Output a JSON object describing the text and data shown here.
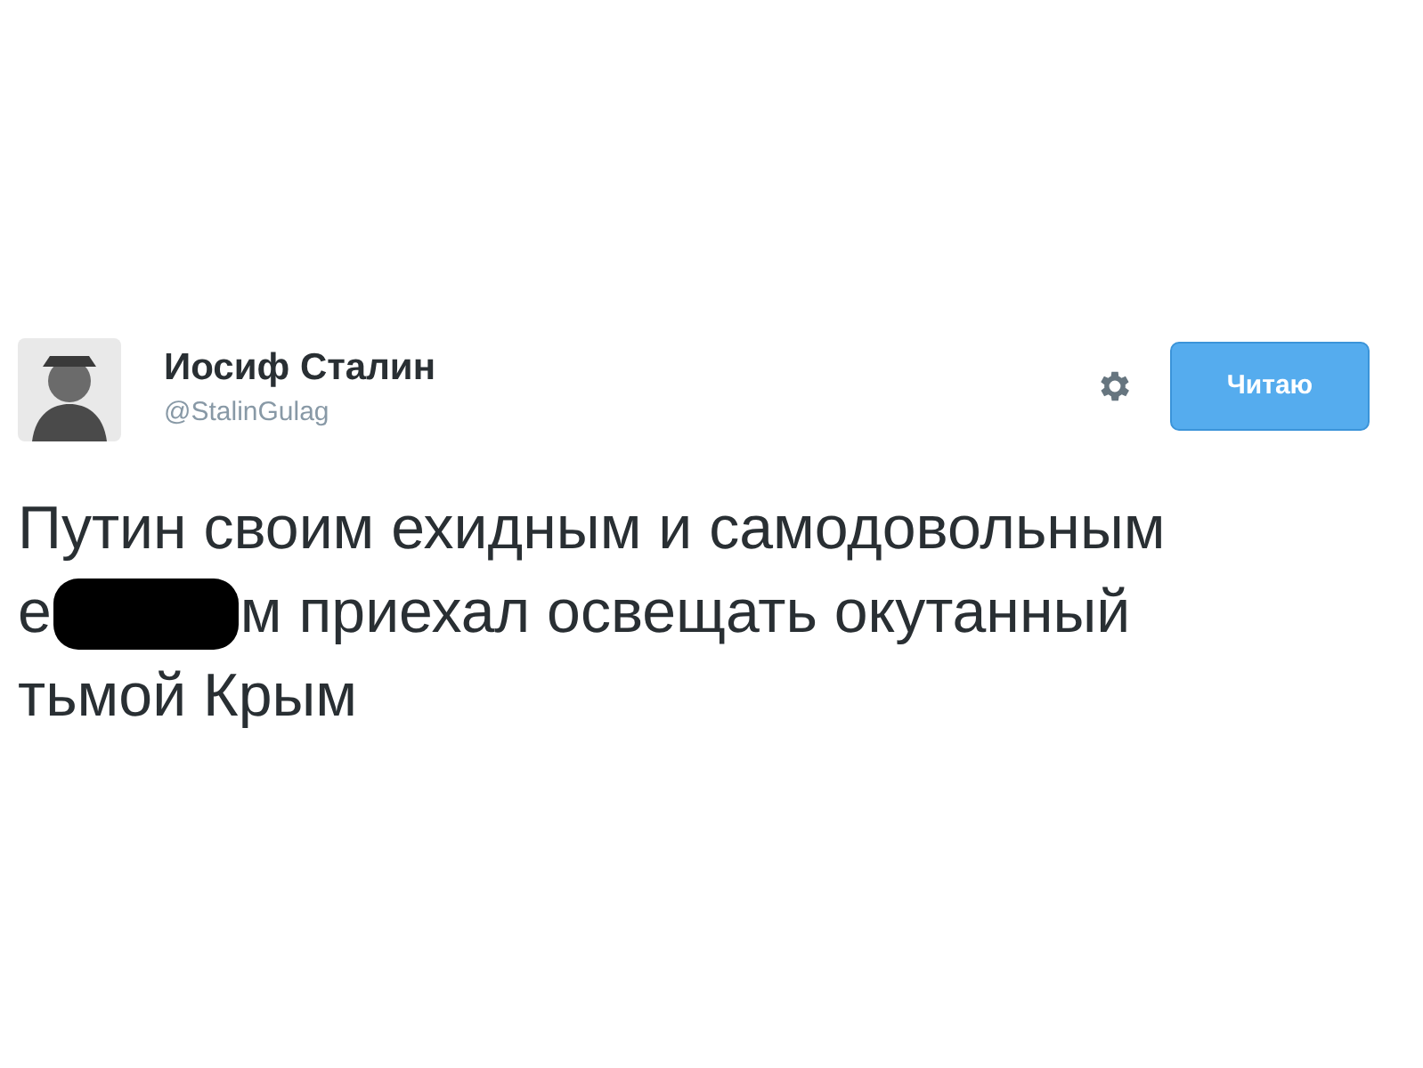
{
  "author": {
    "name": "Иосиф Сталин",
    "handle": "@StalinGulag"
  },
  "follow_button": {
    "label": "Читаю"
  },
  "tweet": {
    "lines": [
      {
        "text": "Путин своим ехидным и самодовольным"
      },
      {
        "text_before": "е",
        "redacted": true,
        "text_after": "м приехал освещать окутанный"
      },
      {
        "text": "тьмой Крым"
      }
    ]
  }
}
